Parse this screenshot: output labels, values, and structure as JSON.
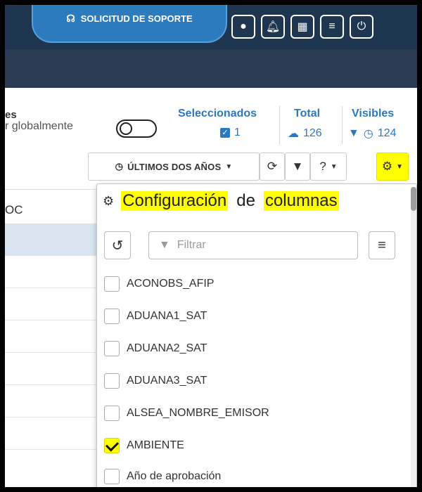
{
  "header": {
    "support_label": "SOLICITUD DE SOPORTE",
    "buttons": [
      "user-icon",
      "bell-icon",
      "grid-icon",
      "menu-icon",
      "power-icon"
    ]
  },
  "summary": {
    "left_label_1": "es",
    "left_label_2": "r globalmente",
    "selected": {
      "title": "Seleccionados",
      "value": "1"
    },
    "total": {
      "title": "Total",
      "value": "126"
    },
    "visible": {
      "title": "Visibles",
      "value": "124"
    }
  },
  "toolbar": {
    "range_label": "ÚLTIMOS DOS AÑOS"
  },
  "table": {
    "header_partial": "OC"
  },
  "column_config": {
    "title_words": [
      "Configuración",
      "de",
      "columnas"
    ],
    "filter_placeholder": "Filtrar",
    "columns": [
      {
        "label": "ACONOBS_AFIP",
        "checked": false
      },
      {
        "label": "ADUANA1_SAT",
        "checked": false
      },
      {
        "label": "ADUANA2_SAT",
        "checked": false
      },
      {
        "label": "ADUANA3_SAT",
        "checked": false
      },
      {
        "label": "ALSEA_NOMBRE_EMISOR",
        "checked": false
      },
      {
        "label": "AMBIENTE",
        "checked": true
      },
      {
        "label": "Año de aprobación",
        "checked": false
      }
    ]
  },
  "colors": {
    "topbar": "#1f3650",
    "accent_blue": "#2b78c2",
    "highlight": "#ffff00"
  }
}
